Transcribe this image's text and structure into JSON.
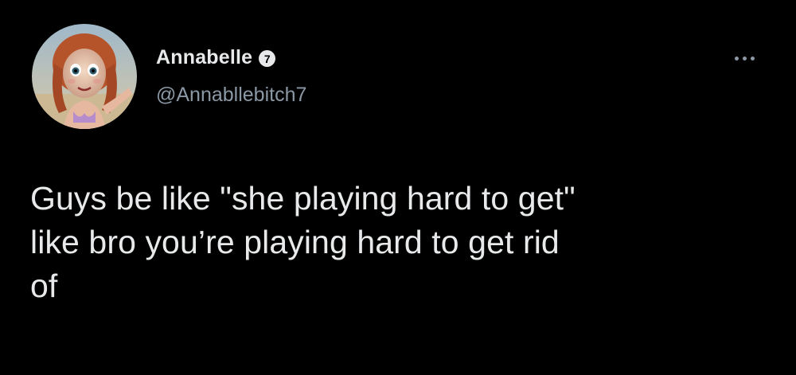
{
  "tweet": {
    "author": {
      "display_name": "Annabelle",
      "badge_text": "7",
      "handle": "@Annabllebitch7",
      "avatar_icon": "doll-portrait-avatar"
    },
    "more_icon": "ellipsis-icon",
    "text_lines": [
      "Guys be like \"she playing hard to get\"",
      "like bro you’re playing hard to get rid",
      "of"
    ]
  },
  "colors": {
    "background": "#000000",
    "primary_text": "#e7e9ea",
    "secondary_text": "#8b98a5"
  }
}
